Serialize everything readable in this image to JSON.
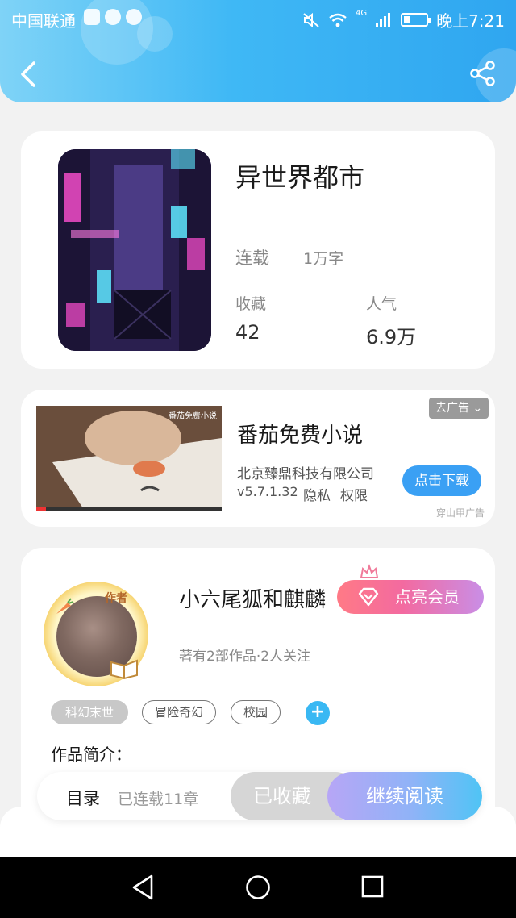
{
  "status_bar": {
    "carrier": "中国联通",
    "time": "晚上7:21",
    "network": "4G"
  },
  "header": {
    "back_icon": "chevron-left-icon",
    "share_icon": "share-icon",
    "gradient_start": "#7fd3f7",
    "gradient_end": "#2fa6f0"
  },
  "book": {
    "title": "异世界都市",
    "status": "连载",
    "word_count": "1万字",
    "favorites_label": "收藏",
    "favorites_value": "42",
    "popularity_label": "人气",
    "popularity_value": "6.9万"
  },
  "ad": {
    "close_label": "去广告",
    "title": "番茄免费小说",
    "company": "北京臻鼎科技有限公司",
    "version": "v5.7.1.32",
    "privacy": "隐私",
    "permissions": "权限",
    "download_label": "点击下载",
    "source": "穿山甲广告",
    "thumb_label": "番茄免费小说"
  },
  "author": {
    "badge": "作者",
    "name": "小六尾狐和麒麟",
    "vip_label": "点亮会员",
    "meta": "著有2部作品·2人关注",
    "tags": [
      "科幻末世",
      "冒险奇幻",
      "校园"
    ],
    "add_tag": "+",
    "intro_label": "作品简介："
  },
  "action_bar": {
    "toc_label": "目录",
    "toc_count": "已连载11章",
    "saved_label": "已收藏",
    "read_label": "继续阅读",
    "accent": "#4fc4f5"
  },
  "colors": {
    "download_button": "#3aa0f4",
    "tag_add": "#39b8f3"
  }
}
